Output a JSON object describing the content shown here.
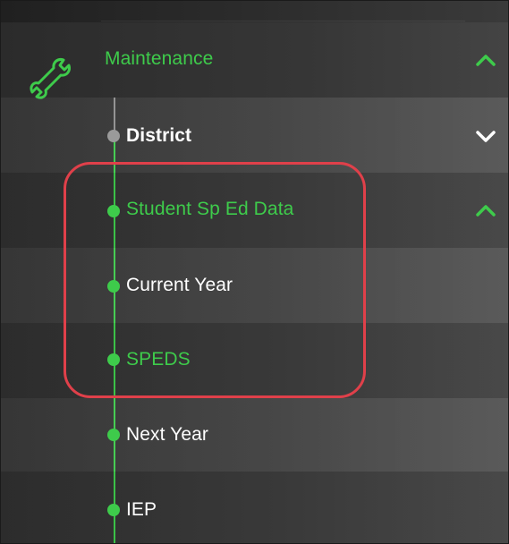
{
  "menu": {
    "section": {
      "label": "Maintenance",
      "icon": "wrench-icon",
      "expanded": true
    },
    "items": [
      {
        "label": "District",
        "color": "#ffffff",
        "bold": true,
        "expanded": false,
        "dot": "grey"
      },
      {
        "label": "Student Sp Ed Data",
        "color": "#3ecb4b",
        "bold": false,
        "expanded": true,
        "dot": "green"
      },
      {
        "label": "Current Year",
        "color": "#ffffff",
        "bold": false,
        "dot": "green"
      },
      {
        "label": "SPEDS",
        "color": "#3ecb4b",
        "bold": false,
        "dot": "green"
      },
      {
        "label": "Next Year",
        "color": "#ffffff",
        "bold": false,
        "dot": "green"
      },
      {
        "label": "IEP",
        "color": "#ffffff",
        "bold": false,
        "dot": "green"
      }
    ]
  },
  "colors": {
    "accent": "#3ecb4b",
    "highlight": "#e0404a",
    "text": "#ffffff"
  }
}
